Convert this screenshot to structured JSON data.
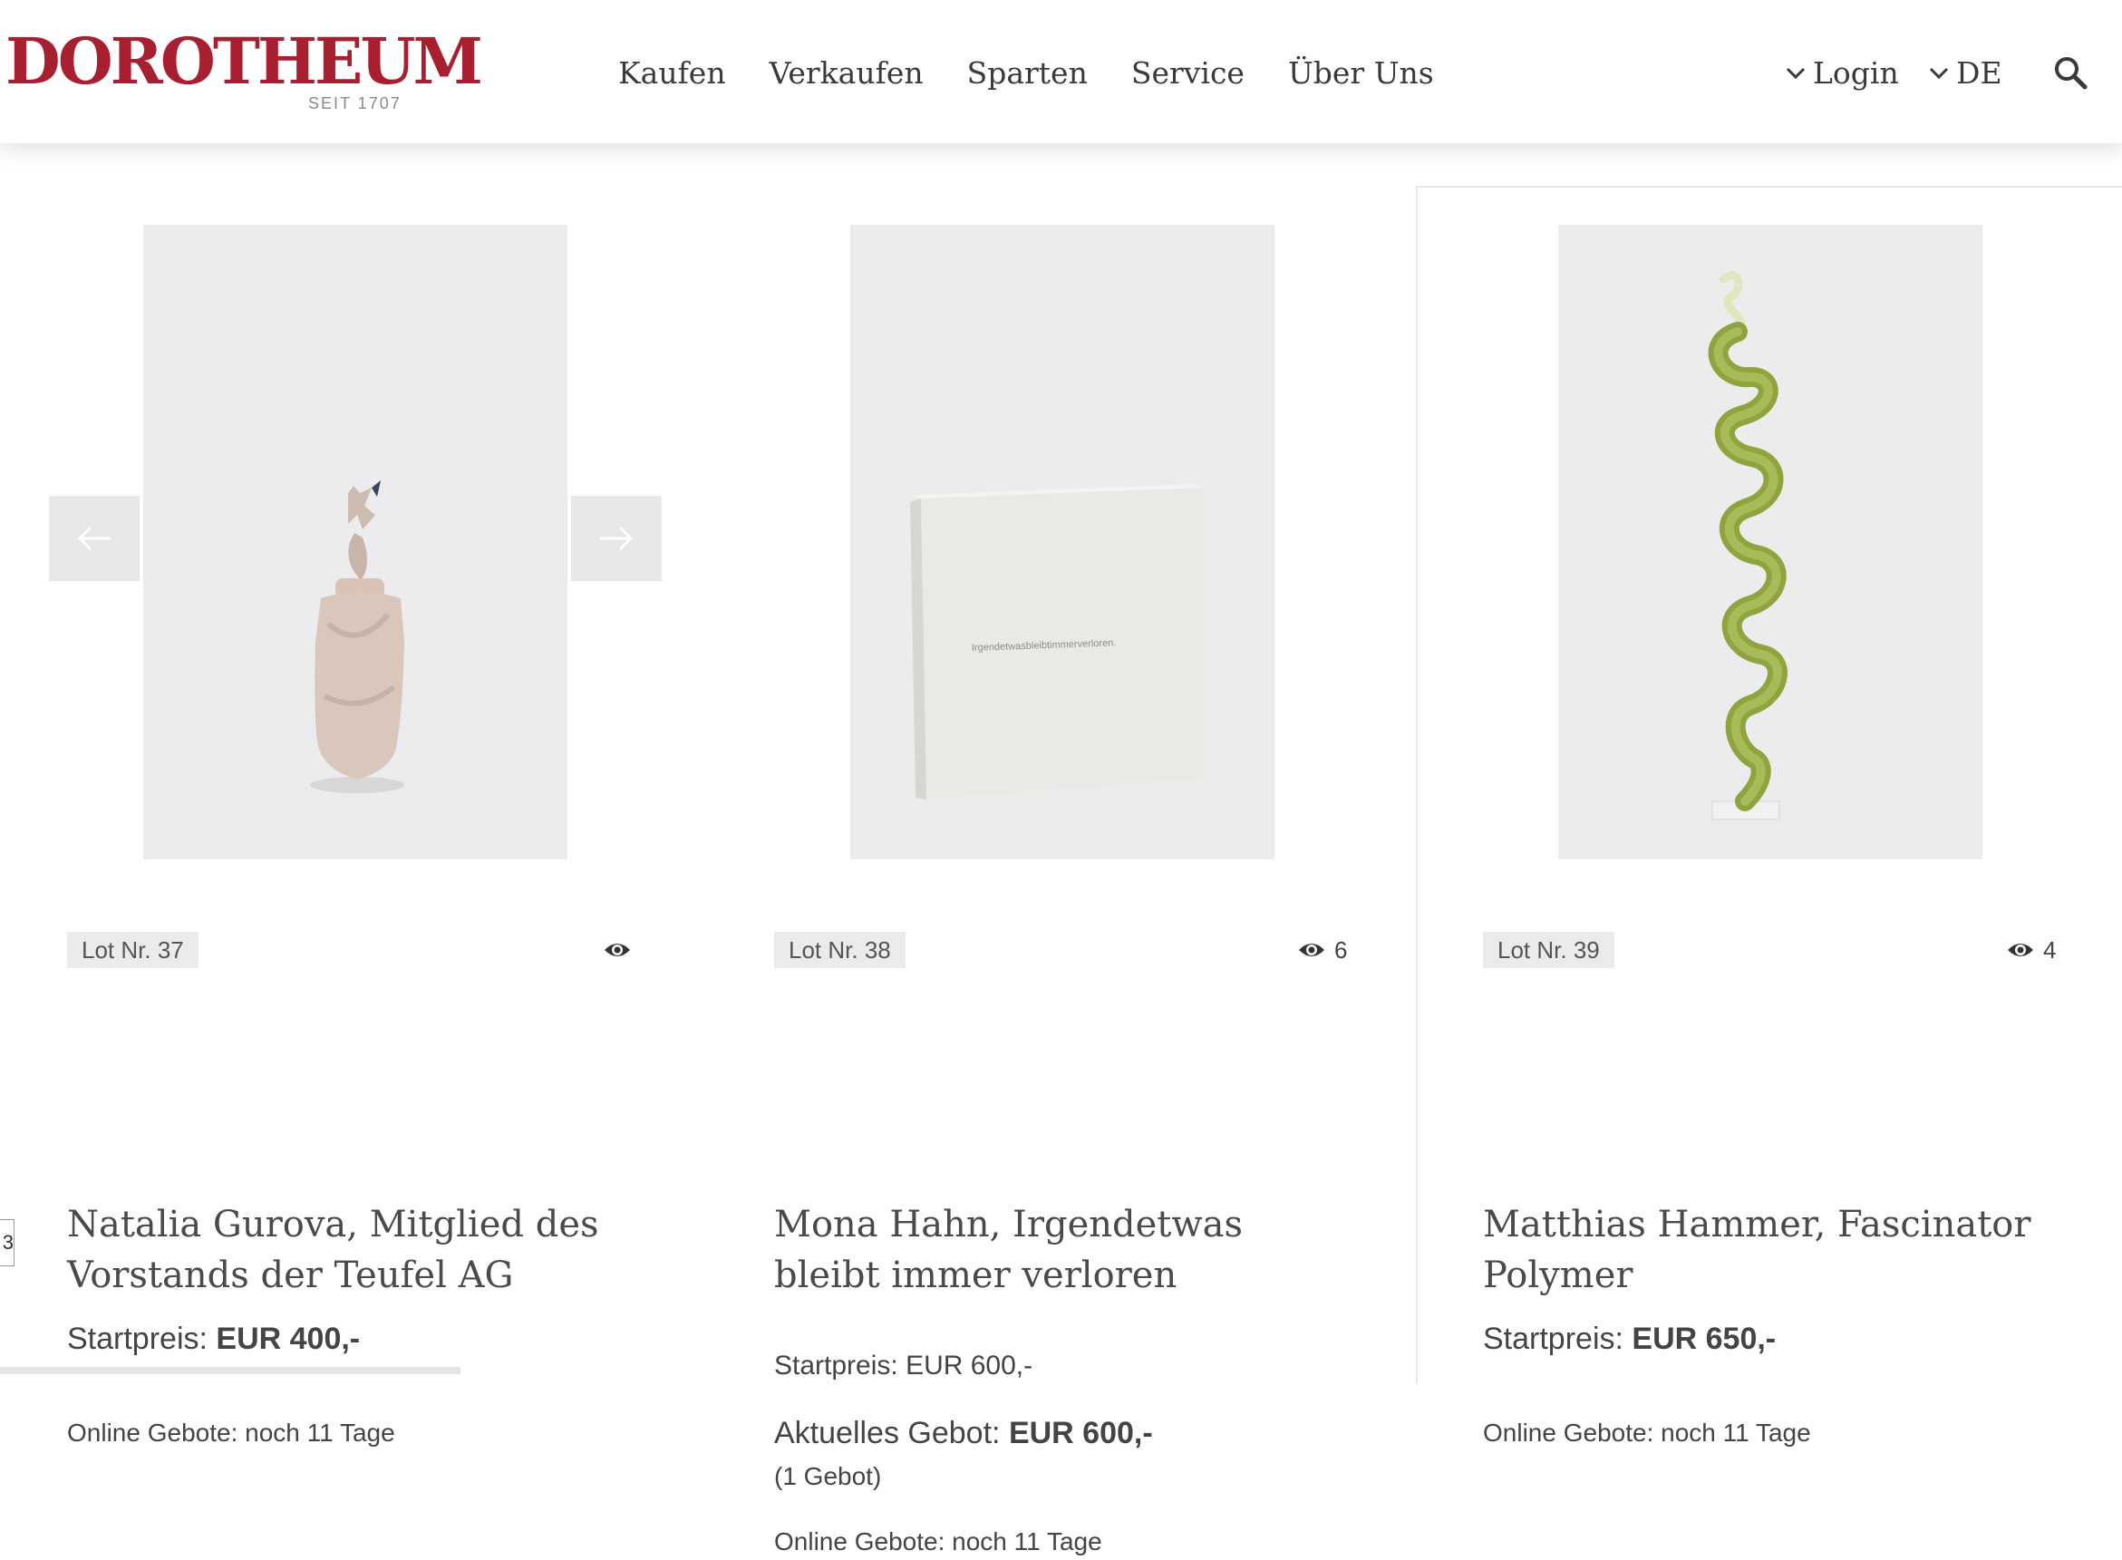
{
  "brand": {
    "name": "DOROTHEUM",
    "tagline": "SEIT 1707",
    "color": "#a81f30"
  },
  "nav": {
    "items": [
      "Kaufen",
      "Verkaufen",
      "Sparten",
      "Service",
      "Über Uns"
    ]
  },
  "utility": {
    "login_label": "Login",
    "language_label": "DE",
    "search_icon": "search-icon"
  },
  "carousel": {
    "prev_icon": "arrow-left-icon",
    "next_icon": "arrow-right-icon"
  },
  "lots": [
    {
      "lot_label": "Lot Nr. 37",
      "views": "",
      "title": "Natalia Gurova, Mitglied des Vorstands der Teufel AG",
      "start_label": "Startpreis:",
      "start_value": "EUR 400,-",
      "online_bids": "Online Gebote: noch 11 Tage"
    },
    {
      "lot_label": "Lot Nr. 38",
      "views": "6",
      "title": "Mona Hahn, Irgendetwas bleibt immer verloren",
      "start_label": "Startpreis:",
      "start_value": "EUR 600,-",
      "current_label": "Aktuelles Gebot:",
      "current_value": "EUR 600,-",
      "bid_count": "(1 Gebot)",
      "online_bids": "Online Gebote: noch 11 Tage",
      "artwork_text": "Irgendetwasbleibtimmerverloren."
    },
    {
      "lot_label": "Lot Nr. 39",
      "views": "4",
      "title": "Matthias Hammer, Fascinator Polymer",
      "start_label": "Startpreis:",
      "start_value": "EUR 650,-",
      "online_bids": "Online Gebote: noch 11 Tage"
    }
  ],
  "edge_tab_text": "3"
}
